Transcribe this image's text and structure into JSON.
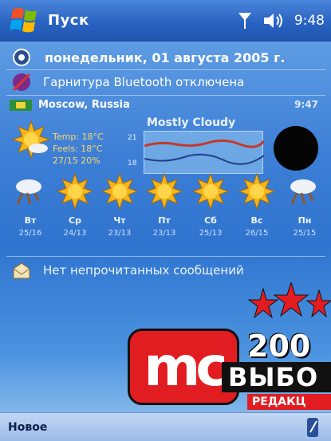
{
  "titlebar": {
    "start_label": "Пуск",
    "time": "9:48"
  },
  "today": {
    "date": "понедельник, 01 августа 2005 г.",
    "bluetooth": "Гарнитура Bluetooth отключена",
    "messages": "Нет непрочитанных сообщений"
  },
  "weather": {
    "location": "Moscow, Russia",
    "time": "9:47",
    "temp": "Temp: 18°C",
    "feels": "Feels: 18°C",
    "details": "27/15  20%",
    "condition": "Mostly Cloudy",
    "axis_top": "21",
    "axis_bottom": "18",
    "days": [
      {
        "name": "Вт",
        "range": "25/16",
        "icon": "cloudy-icon"
      },
      {
        "name": "Ср",
        "range": "24/13",
        "icon": "sunny-icon"
      },
      {
        "name": "Чт",
        "range": "23/13",
        "icon": "sunny-icon"
      },
      {
        "name": "Пт",
        "range": "23/13",
        "icon": "sunny-icon"
      },
      {
        "name": "Сб",
        "range": "25/13",
        "icon": "sunny-icon"
      },
      {
        "name": "Вс",
        "range": "26/15",
        "icon": "sunny-icon"
      },
      {
        "name": "Пн",
        "range": "25/15",
        "icon": "cloudy-icon"
      }
    ]
  },
  "softkeys": {
    "left": "Новое"
  },
  "badge": {
    "mc": "mc",
    "year": "200",
    "choice": "ВЫБО",
    "editorial": "РЕДАКЦ"
  },
  "colors": {
    "accent": "#2f74cf",
    "badge_red": "#e21d22",
    "sun": "#f5b51a"
  }
}
